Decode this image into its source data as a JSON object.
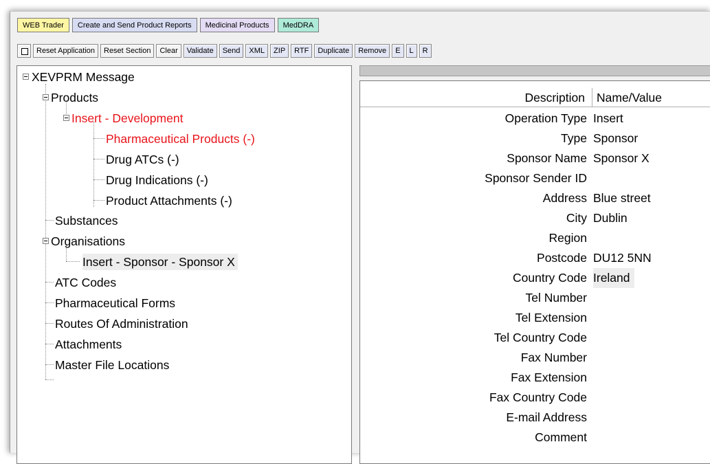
{
  "tabs": [
    {
      "label": "WEB Trader"
    },
    {
      "label": "Create and Send Product Reports"
    },
    {
      "label": "Medicinal Products"
    },
    {
      "label": "MedDRA"
    }
  ],
  "toolbar": {
    "reset_application": "Reset Application",
    "reset_section": "Reset Section",
    "clear": "Clear",
    "validate": "Validate",
    "send": "Send",
    "xml": "XML",
    "zip": "ZIP",
    "rtf": "RTF",
    "duplicate": "Duplicate",
    "remove": "Remove",
    "e": "E",
    "l": "L",
    "r": "R"
  },
  "tree": {
    "root": "XEVPRM Message",
    "products": "Products",
    "insert_development": "Insert - Development",
    "pharmaceutical_products": "Pharmaceutical Products (-)",
    "drug_atcs": "Drug ATCs (-)",
    "drug_indications": "Drug Indications (-)",
    "product_attachments": "Product Attachments (-)",
    "substances": "Substances",
    "organisations": "Organisations",
    "insert_sponsor": "Insert - Sponsor - Sponsor X",
    "atc_codes": "ATC Codes",
    "pharmaceutical_forms": "Pharmaceutical Forms",
    "routes_of_administration": "Routes Of Administration",
    "attachments": "Attachments",
    "master_file_locations": "Master File Locations"
  },
  "grid": {
    "headers": {
      "description": "Description",
      "value": "Name/Value"
    },
    "rows": [
      {
        "description": "Operation Type",
        "value": "Insert"
      },
      {
        "description": "Type",
        "value": "Sponsor"
      },
      {
        "description": "Sponsor Name",
        "value": "Sponsor X"
      },
      {
        "description": "Sponsor Sender ID",
        "value": ""
      },
      {
        "description": "Address",
        "value": "Blue street"
      },
      {
        "description": "City",
        "value": "Dublin"
      },
      {
        "description": "Region",
        "value": ""
      },
      {
        "description": "Postcode",
        "value": "DU12 5NN"
      },
      {
        "description": "Country Code",
        "value": "Ireland"
      },
      {
        "description": "Tel Number",
        "value": ""
      },
      {
        "description": "Tel Extension",
        "value": ""
      },
      {
        "description": "Tel Country Code",
        "value": ""
      },
      {
        "description": "Fax Number",
        "value": ""
      },
      {
        "description": "Fax Extension",
        "value": ""
      },
      {
        "description": "Fax Country Code",
        "value": ""
      },
      {
        "description": "E-mail Address",
        "value": ""
      },
      {
        "description": "Comment",
        "value": ""
      }
    ]
  },
  "colors": {
    "red_node": "#e8141b",
    "tab_web": "#fff6a3",
    "tab_create": "#d8dcf3",
    "tab_medicinal": "#e4dcf4",
    "tab_meddra": "#aeead8"
  }
}
